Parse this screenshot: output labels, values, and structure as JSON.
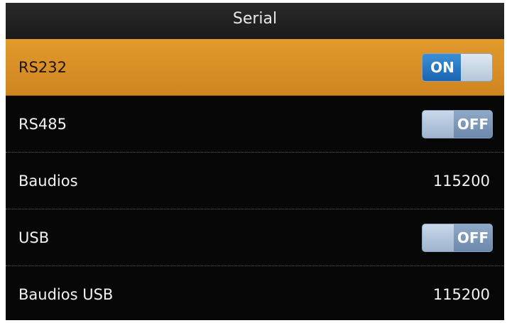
{
  "header": {
    "title": "Serial"
  },
  "rows": [
    {
      "label": "RS232",
      "type": "toggle",
      "state": "ON",
      "selected": true
    },
    {
      "label": "RS485",
      "type": "toggle",
      "state": "OFF",
      "selected": false
    },
    {
      "label": "Baudios",
      "type": "value",
      "value": "115200",
      "selected": false
    },
    {
      "label": "USB",
      "type": "toggle",
      "state": "OFF",
      "selected": false
    },
    {
      "label": "Baudios USB",
      "type": "value",
      "value": "115200",
      "selected": false
    }
  ],
  "colors": {
    "selected_row": "#e19a2c",
    "toggle_on": "#1c64b0",
    "toggle_off": "#6d88ab",
    "background": "#070707"
  }
}
